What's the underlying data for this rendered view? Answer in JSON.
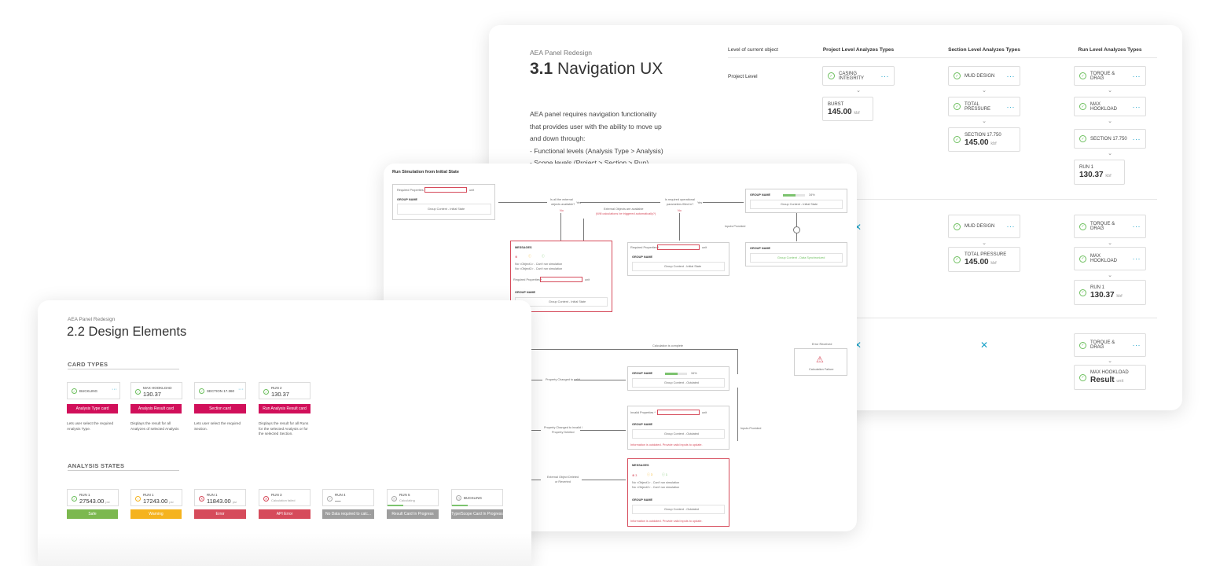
{
  "panel31": {
    "subtitle": "AEA Panel Redesign",
    "title_num": "3.1",
    "title_text": "Navigation UX",
    "description": [
      "AEA panel requires navigation functionality",
      "that provides user with the ability to move up",
      "and down through:",
      "- Functional levels (Analysis Type > Analysis)",
      "- Scope levels (Project > Section > Run)"
    ],
    "col_headers": [
      "Level of current object",
      "Project Level Analyzes Types",
      "Section Level Analyzes Types",
      "Run Level Analyzes Types"
    ],
    "row_label": "Project Level",
    "cards": {
      "casing": "CASING INTEGRITY",
      "burst": "BURST",
      "burst_val": "145.00",
      "unit": "kbf",
      "mud": "MUD DESIGN",
      "total_pressure": "TOTAL PRESSURE",
      "section": "SECTION 17.750",
      "section_val": "145.00",
      "torque": "TORQUE & DRAG",
      "max_hook": "MAX HOOKLOAD",
      "section2": "SECTION 17.750",
      "run1": "RUN 1",
      "run1_val": "130.37",
      "tp_val": "145.00",
      "result": "Result",
      "result_unit": "unit"
    }
  },
  "sim": {
    "title": "Run Simulation from Initial State",
    "required_props": "Required Properties *",
    "invalid_props": "Invalid Properties *",
    "group_name": "GROUP NAME",
    "group_content": "Group Content - Initial State",
    "group_content_success": "Group Content - Data Synchronized",
    "group_content_outdated": "Group Content - Outdated",
    "unit": "unit",
    "q1a": "Is all the external",
    "q1b": "objects available?",
    "q2a": "Is required operational",
    "q2b": "parameters filled in?",
    "yes": "Yes",
    "no": "No",
    "ext_a": "External Objects are available",
    "ext_b": "(Will calculations be triggered automatically?)",
    "inputs_provided": "Inputs Provided",
    "messages": "MESSAGES",
    "msg1": "No <Object1> - Can't run simulation",
    "msg2": "No <Object2> - Can't run simulation",
    "calc_complete": "Calculation is complete",
    "error_received": "Error Received",
    "calc_failed": "Calculation Failure",
    "prop_changed": "Property Changed to valid",
    "prop_invalid_a": "Property Changed to invalid /",
    "prop_invalid_b": "Property Deleted",
    "ext_deleted_a": "External Object Deleted",
    "ext_deleted_b": "or Reverted",
    "info_outdated": "Information is outdated. Provide valid inputs to update.",
    "pct": "34%"
  },
  "panel22": {
    "subtitle": "AEA Panel Redesign",
    "title_num": "2.2",
    "title_text": "Design Elements",
    "card_types_h": "CARD TYPES",
    "analysis_states_h": "ANALYSIS STATES",
    "card_types": [
      {
        "label": "BUCKLING",
        "tag": "Analysis Type card",
        "desc": "Lets user select the required Analysis Type."
      },
      {
        "label": "MAX HOOKLOAD",
        "value": "130.37",
        "tag": "Analysis Result card",
        "desc": "Displays the result for all Analyzes of selected Analysis"
      },
      {
        "label": "SECTION 17.360",
        "tag": "Section card",
        "desc": "Lets user select the required Section."
      },
      {
        "label": "RUN 2",
        "value": "130.37",
        "tag": "Run Analysis Result card",
        "desc": "Displays the result for all Runs for the selected Analysis or for the selected Section."
      }
    ],
    "states": [
      {
        "label": "RUN 1",
        "value": "27543.00",
        "unit": "psi",
        "tag": "Safe",
        "color": "#7cb84f"
      },
      {
        "label": "RUN 1",
        "value": "17243.00",
        "unit": "psi",
        "tag": "Warning",
        "color": "#f5b31e"
      },
      {
        "label": "RUN 1",
        "value": "11843.00",
        "unit": "psi",
        "tag": "Error",
        "color": "#d64b5b"
      },
      {
        "label": "RUN 3",
        "value": "Calculation failed",
        "unit": "",
        "tag": "API Error",
        "color": "#d64b5b"
      },
      {
        "label": "RUN 4",
        "value": "—",
        "unit": "",
        "tag": "No Data required to calc...",
        "color": "#9e9e9e"
      },
      {
        "label": "RUN 5",
        "value": "Calculating",
        "unit": "",
        "tag": "Result Card In Progress",
        "color": "#9e9e9e"
      },
      {
        "label": "BUCKLING",
        "value": "",
        "unit": "",
        "tag": "Type/Scope Card In Progress",
        "color": "#9e9e9e"
      }
    ]
  }
}
